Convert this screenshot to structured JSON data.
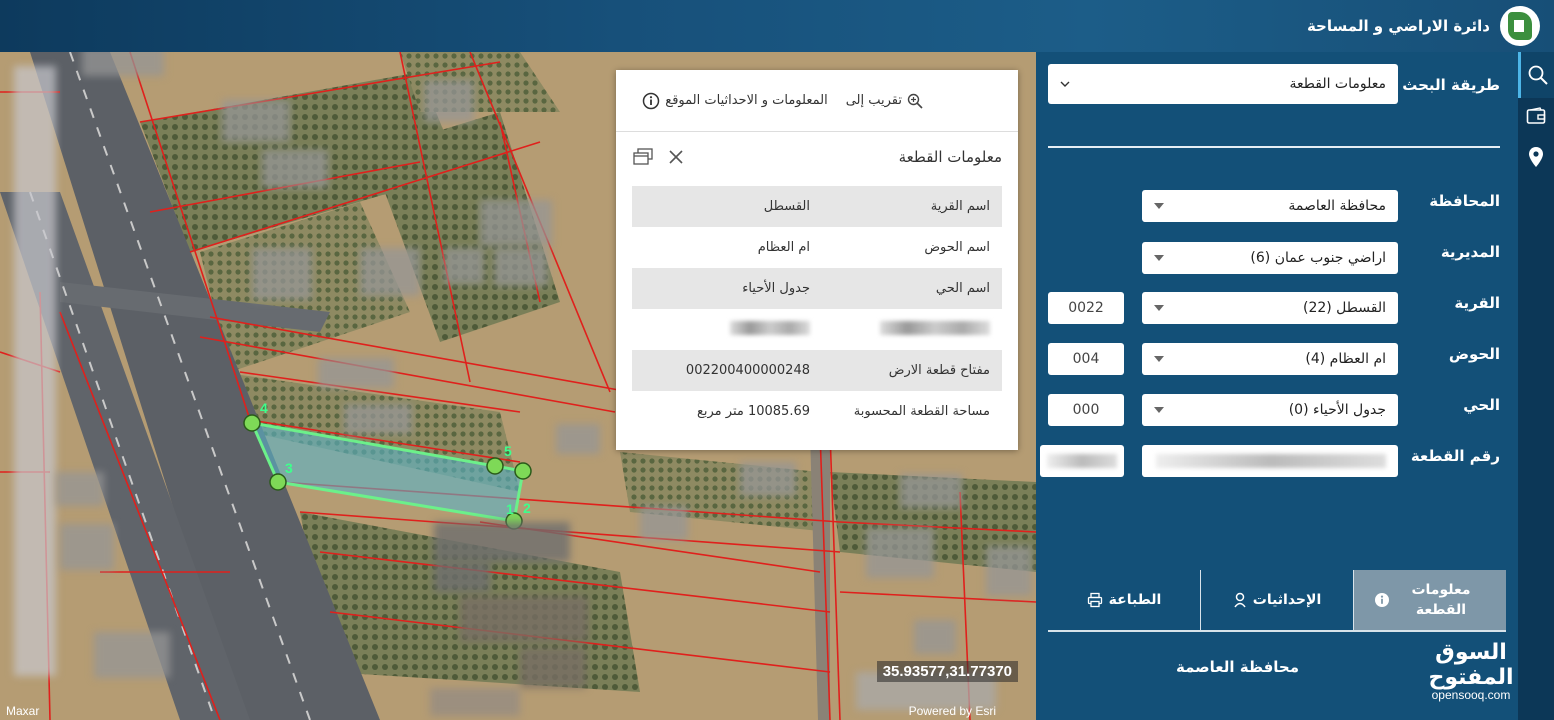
{
  "header": {
    "title": "دائرة الاراضي و المساحة"
  },
  "search": {
    "method_label": "طريقة البحث",
    "method_value": "معلومات القطعة",
    "fields": {
      "governorate": {
        "label": "المحافظة",
        "value": "محافظة العاصمة"
      },
      "directorate": {
        "label": "المديرية",
        "value": "اراضي جنوب عمان (6)"
      },
      "village": {
        "label": "القرية",
        "value": "القسطل (22)",
        "code": "0022"
      },
      "basin": {
        "label": "الحوض",
        "value": "ام العظام (4)",
        "code": "004"
      },
      "district": {
        "label": "الحي",
        "value": "جدول الأحياء (0)",
        "code": "000"
      },
      "parcel": {
        "label": "رقم القطعة",
        "value": ""
      }
    }
  },
  "tabs": [
    {
      "label": "معلومات القطعة",
      "icon": "info-icon",
      "active": true
    },
    {
      "label": "الإحداثيات",
      "icon": "location-pin-icon",
      "active": false
    },
    {
      "label": "الطباعة",
      "icon": "printer-icon",
      "active": false
    }
  ],
  "region_text": "محافظة العاصمة",
  "popup": {
    "zoom_label": "تقريب إلى",
    "info_label": "المعلومات و الاحداثيات الموقع",
    "title": "معلومات القطعة",
    "rows": [
      {
        "key": "اسم القرية",
        "value": "القسطل"
      },
      {
        "key": "اسم الحوض",
        "value": "ام العظام"
      },
      {
        "key": "اسم الحي",
        "value": "جدول الأحياء"
      },
      {
        "key": "",
        "value": ""
      },
      {
        "key": "مفتاح قطعة الارض",
        "value": "002200400000248"
      },
      {
        "key": "مساحة القطعة المحسوبة",
        "value": "10085.69 متر مربع"
      }
    ]
  },
  "map": {
    "coords": "35.93577,31.77370",
    "attribution_left": "Maxar",
    "attribution_right": "Powered by Esri",
    "vertices": [
      "1",
      "2",
      "3",
      "4",
      "5"
    ],
    "parcel_fill": "#5ab4c8",
    "parcel_edge": "#6cf08a",
    "boundary_color": "#e0201c"
  },
  "watermark": {
    "arabic": "السوق المفتوح",
    "latin": "opensooq.com"
  }
}
